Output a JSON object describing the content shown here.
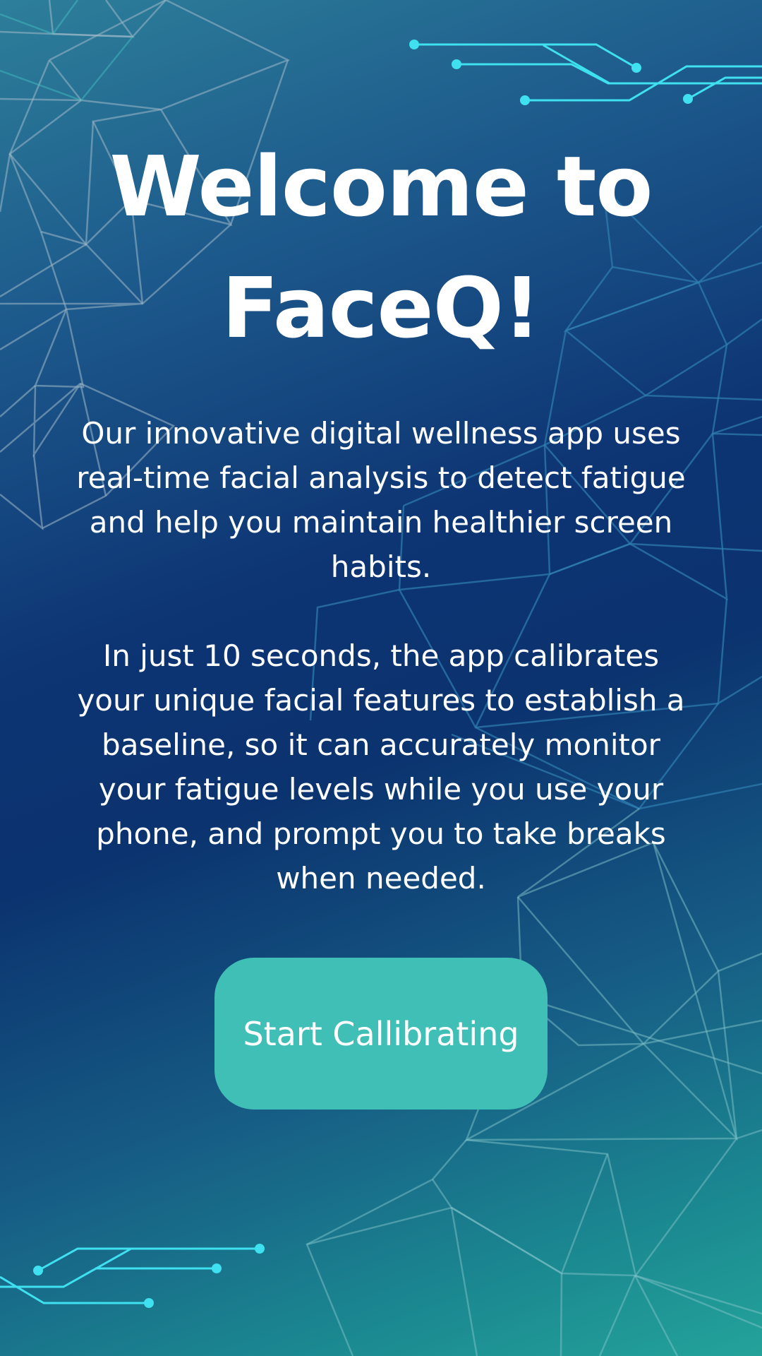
{
  "welcome": {
    "title_line1": "Welcome to",
    "title_line2": "FaceQ!",
    "paragraph1": "Our innovative digital wellness app uses real-time facial analysis to detect fatigue and help you maintain healthier screen habits.",
    "paragraph2": "In just 10 seconds, the app calibrates your unique facial features to establish a baseline, so it can accurately monitor your fatigue levels while you use your phone, and prompt you to take breaks when needed.",
    "button_label": "Start Callibrating"
  },
  "colors": {
    "background_dark": "#0b336f",
    "background_teal": "#24a39a",
    "button": "#40bfb6",
    "circuit_accent": "#3fe0ef",
    "text": "#ffffff"
  }
}
